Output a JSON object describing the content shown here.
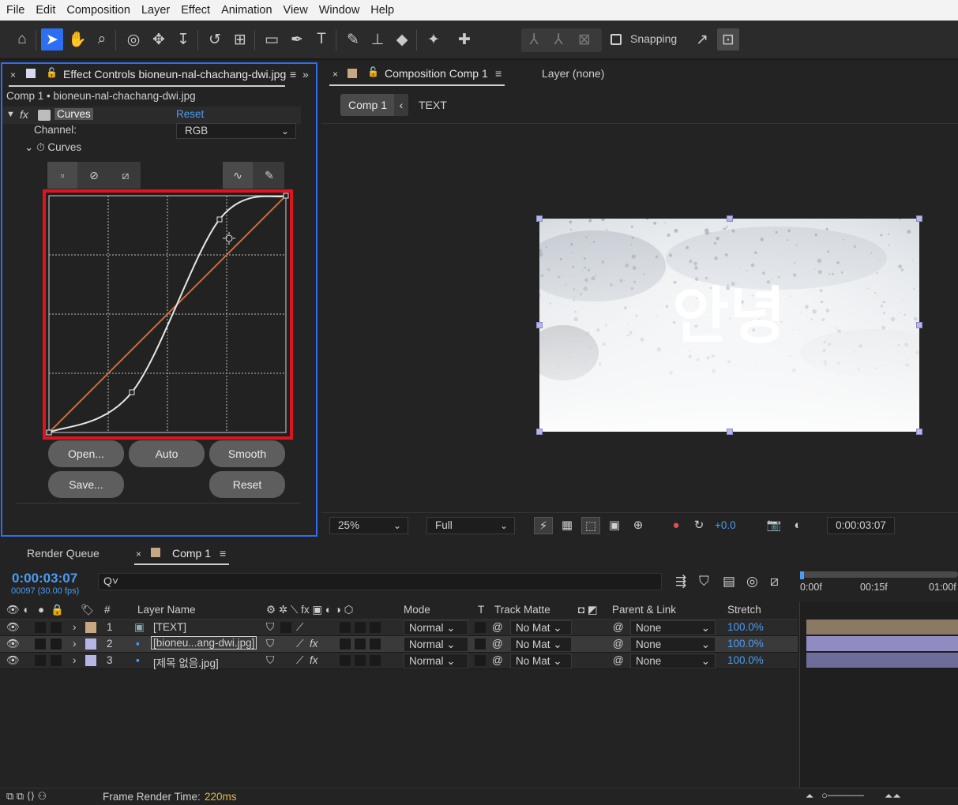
{
  "menu": [
    "File",
    "Edit",
    "Composition",
    "Layer",
    "Effect",
    "Animation",
    "View",
    "Window",
    "Help"
  ],
  "toolbar": {
    "snapping_label": "Snapping",
    "tools": [
      "home-icon",
      "selection-tool-icon",
      "hand-tool-icon",
      "zoom-tool-icon",
      "orbit-camera-icon",
      "pan-camera-icon",
      "dolly-camera-icon",
      "rotate-tool-icon",
      "pan-behind-icon",
      "rectangle-tool-icon",
      "pen-tool-icon",
      "type-tool-icon",
      "brush-tool-icon",
      "clone-stamp-icon",
      "eraser-tool-icon",
      "roto-brush-icon",
      "puppet-pin-icon"
    ]
  },
  "effect_controls": {
    "tab_title": "Effect Controls bioneun-nal-chachang-dwi.jpg",
    "subtitle": "Comp 1 • bioneun-nal-chachang-dwi.jpg",
    "fx": "fx",
    "effect_name": "Curves",
    "reset_link": "Reset",
    "channel_label": "Channel:",
    "channel_value": "RGB",
    "curves_property": "Curves",
    "buttons": {
      "open": "Open...",
      "auto": "Auto",
      "smooth": "Smooth",
      "save": "Save...",
      "reset": "Reset"
    },
    "curve_points": [
      [
        0,
        0
      ],
      [
        0.35,
        0.17
      ],
      [
        0.72,
        0.9
      ],
      [
        1,
        1
      ]
    ]
  },
  "composition": {
    "tab_title": "Composition Comp 1",
    "layer_tab": "Layer (none)",
    "crumb": "Comp 1",
    "crumb_next": "TEXT",
    "overlay_text": "안녕",
    "footer": {
      "zoom": "25%",
      "resolution": "Full",
      "exposure": "+0.0",
      "timecode": "0:00:03:07"
    }
  },
  "timeline": {
    "render_queue_tab": "Render Queue",
    "comp_tab": "Comp 1",
    "current_time": "0:00:03:07",
    "fps_info": "00097 (30.00 fps)",
    "search_placeholder": "Q˅",
    "ruler": [
      "0:00f",
      "00:15f",
      "01:00f"
    ],
    "columns": {
      "num": "#",
      "layer_name": "Layer Name",
      "mode": "Mode",
      "t": "T",
      "track_matte": "Track Matte",
      "parent": "Parent & Link",
      "stretch": "Stretch"
    },
    "layers": [
      {
        "num": "1",
        "name": "[TEXT]",
        "mode": "Normal",
        "matte": "No Mat",
        "parent": "None",
        "stretch": "100.0%",
        "color": "#c8a882",
        "type": "text-layer-icon"
      },
      {
        "num": "2",
        "name": "[bioneu...ang-dwi.jpg]",
        "mode": "Normal",
        "matte": "No Mat",
        "parent": "None",
        "stretch": "100.0%",
        "color": "#b7b4e6",
        "type": "footage-icon"
      },
      {
        "num": "3",
        "name": "[제목 없음.jpg]",
        "mode": "Normal",
        "matte": "No Mat",
        "parent": "None",
        "stretch": "100.0%",
        "color": "#b7b4e6",
        "type": "footage-icon"
      }
    ],
    "status_label": "Frame Render Time:",
    "status_value": "220ms"
  },
  "colors": {
    "accent": "#2d6ff0",
    "link": "#4b9cf5",
    "highlight": "#e0141e",
    "curve": "#c87137"
  }
}
